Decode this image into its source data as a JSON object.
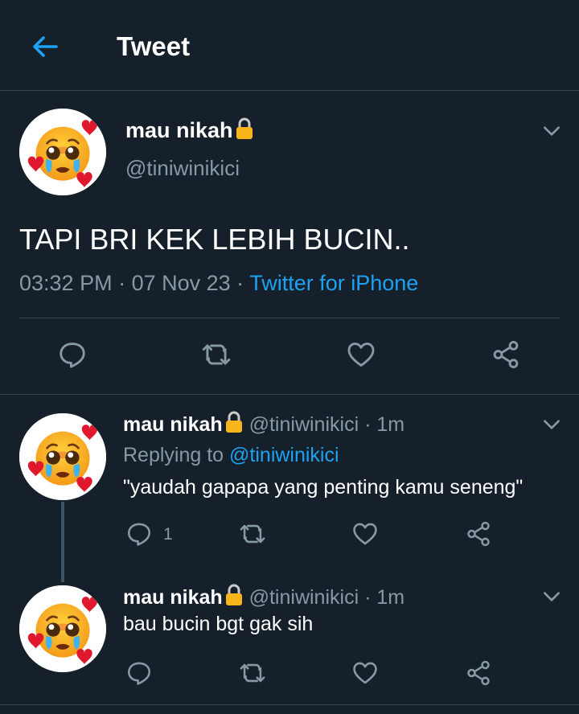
{
  "header": {
    "title": "Tweet",
    "back_icon": "arrow-left-icon"
  },
  "colors": {
    "background": "#15202b",
    "accent": "#1da1f2",
    "muted": "#8899a6",
    "divider": "#38444d"
  },
  "main_tweet": {
    "display_name": "mau nikah",
    "lock_icon": "lock-icon",
    "handle": "@tiniwinikici",
    "text": "TAPI BRI KEK LEBIH BUCIN..",
    "time": "03:32 PM",
    "date": "07 Nov 23",
    "separator": " · ",
    "source": "Twitter for iPhone",
    "actions": [
      "reply-icon",
      "retweet-icon",
      "like-icon",
      "share-icon"
    ]
  },
  "replies": [
    {
      "display_name": "mau nikah",
      "handle": "@tiniwinikici",
      "time_ago": "1m",
      "dot": " · ",
      "replying_label": "Replying to ",
      "replying_to": "@tiniwinikici",
      "text": "\"yaudah gapapa yang penting kamu seneng\"",
      "reply_count": "1"
    },
    {
      "display_name": "mau nikah",
      "handle": "@tiniwinikici",
      "time_ago": "1m",
      "dot": " · ",
      "text": "bau bucin bgt gak sih",
      "reply_count": ""
    }
  ]
}
